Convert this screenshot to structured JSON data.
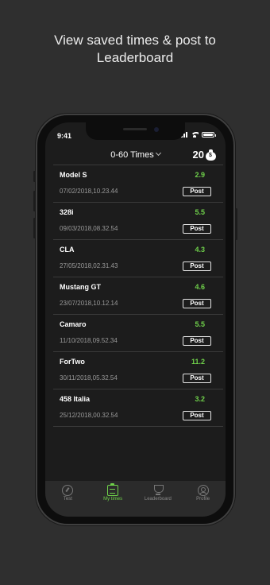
{
  "headline": {
    "line1": "View saved times & post to",
    "line2": "Leaderboard"
  },
  "status_bar": {
    "time": "9:41"
  },
  "header": {
    "title": "0-60 Times",
    "coins": "20",
    "coin_icon": "money-bag-icon"
  },
  "colors": {
    "accent": "#6fd14a",
    "background": "#1c1c1c",
    "outer_background": "#2f2f2f"
  },
  "times": [
    {
      "car": "Model S",
      "time": "2.9",
      "date": "07/02/2018,10.23.44",
      "action": "Post"
    },
    {
      "car": "328i",
      "time": "5.5",
      "date": "09/03/2018,08.32.54",
      "action": "Post"
    },
    {
      "car": "CLA",
      "time": "4.3",
      "date": "27/05/2018,02.31.43",
      "action": "Post"
    },
    {
      "car": "Mustang GT",
      "time": "4.6",
      "date": "23/07/2018,10.12.14",
      "action": "Post"
    },
    {
      "car": "Camaro",
      "time": "5.5",
      "date": "11/10/2018,09.52.34",
      "action": "Post"
    },
    {
      "car": "ForTwo",
      "time": "11.2",
      "date": "30/11/2018,05.32.54",
      "action": "Post"
    },
    {
      "car": "458 Italia",
      "time": "3.2",
      "date": "25/12/2018,00.32.54",
      "action": "Post"
    }
  ],
  "tabs": [
    {
      "label": "Test",
      "icon": "speedometer-icon",
      "active": false
    },
    {
      "label": "My times",
      "icon": "clipboard-icon",
      "active": true
    },
    {
      "label": "Leaderboard",
      "icon": "trophy-icon",
      "active": false
    },
    {
      "label": "Profile",
      "icon": "profile-icon",
      "active": false
    }
  ]
}
